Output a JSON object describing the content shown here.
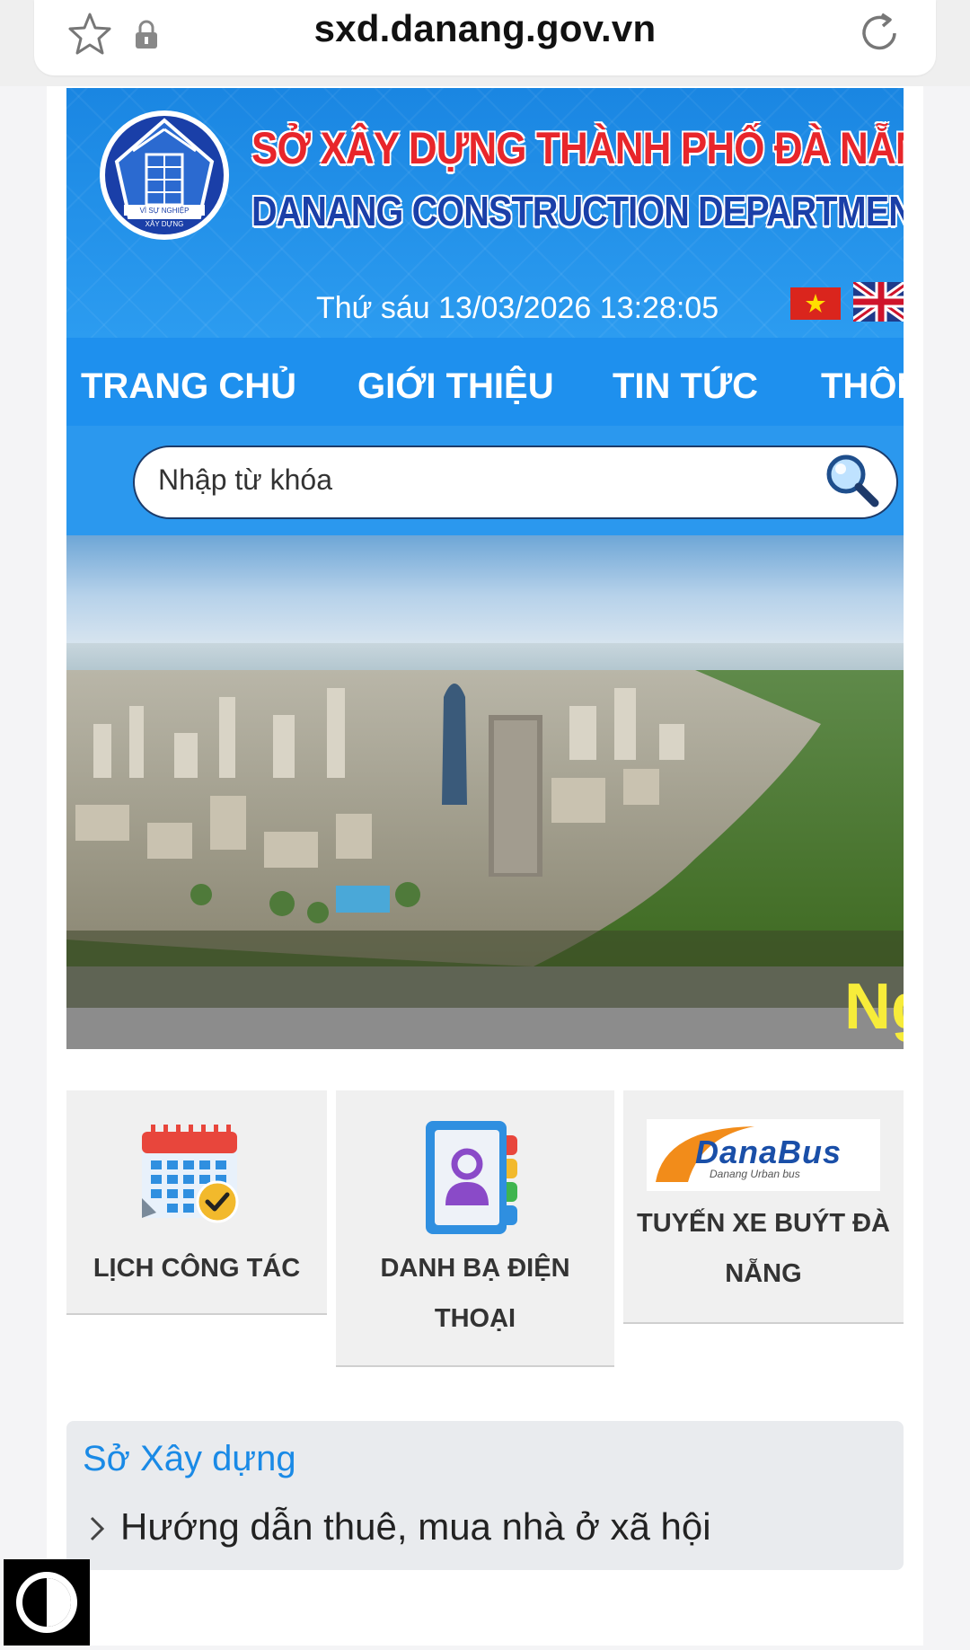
{
  "browser": {
    "url": "sxd.danang.gov.vn",
    "icons": [
      "star-icon",
      "lock-icon",
      "reload-icon"
    ]
  },
  "header": {
    "logo_text_top": "VÌ SỰ NGHIỆP",
    "logo_text_bottom": "XÂY DỰNG",
    "title_vn": "SỞ XÂY DỰNG THÀNH PHỐ ĐÀ NẴNG",
    "title_en": "DANANG CONSTRUCTION DEPARTMENT",
    "datetime": "Thứ sáu 13/03/2026 13:28:05"
  },
  "nav": {
    "items": [
      {
        "label": "TRANG CHỦ"
      },
      {
        "label": "GIỚI THIỆU"
      },
      {
        "label": "TIN TỨC"
      },
      {
        "label": "THÔNG T"
      }
    ]
  },
  "search": {
    "placeholder": "Nhập từ khóa"
  },
  "hero": {
    "caption": "Ng"
  },
  "quick_links": [
    {
      "label": "LỊCH CÔNG TÁC",
      "icon": "calendar-icon"
    },
    {
      "label_line1": "DANH BẠ ĐIỆN",
      "label_line2": "THOẠI",
      "icon": "contacts-book-icon"
    },
    {
      "logo_text": "DanaBus",
      "logo_sub": "Danang Urban bus",
      "label_line1": "TUYẾN XE BUÝT ĐÀ",
      "label_line2": "NẴNG"
    }
  ],
  "news": {
    "section_title": "Sở Xây dựng",
    "items": [
      {
        "title": "Hướng dẫn thuê, mua nhà ở xã hội"
      }
    ]
  },
  "colors": {
    "header_blue": "#1e8ee8",
    "title_red": "#e8262b",
    "title_navy": "#1a3fa8",
    "caption_yellow": "#f7ec3a",
    "link_blue": "#1a8ae6"
  }
}
